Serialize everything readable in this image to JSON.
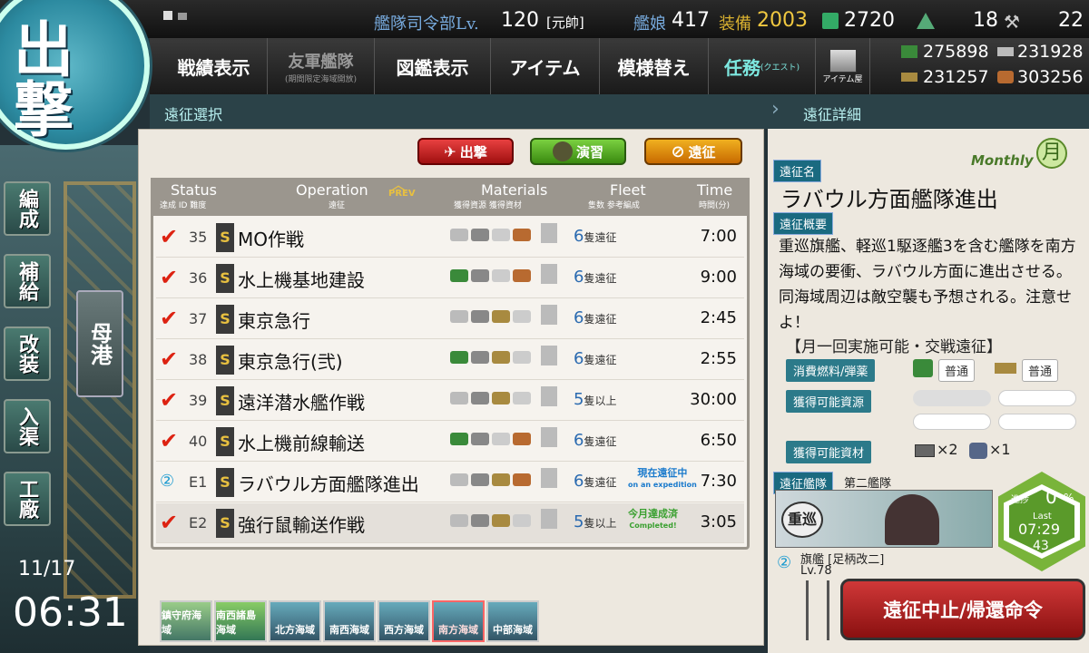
{
  "header": {
    "hq_label": "艦隊司令部Lv.",
    "hq_level": "120",
    "rank": "[元帥]",
    "ships_label": "艦娘",
    "ships": "417",
    "equip_label": "装備",
    "equip": "2003",
    "bucket": "2720",
    "devmat": "18",
    "screws": "22"
  },
  "resources": {
    "fuel": "275898",
    "ammo": "231928",
    "steel": "231257",
    "bauxite": "303256"
  },
  "menu": {
    "record": "戦績表示",
    "friend": "友軍艦隊",
    "friend_sub": "(期間限定海域開放)",
    "album": "図鑑表示",
    "item": "アイテム",
    "remodel": "模様替え",
    "quest": "任務",
    "quest_sub": "(クエスト)",
    "shop": "アイテム屋"
  },
  "sections": {
    "left": "遠征選択",
    "right": "遠征詳細"
  },
  "sortie": "出撃",
  "sidebar": {
    "fleet": "編成",
    "supply": "補給",
    "remodel": "改装",
    "dock": "入渠",
    "factory": "工廠",
    "home": "母港"
  },
  "clock": {
    "date": "11/17",
    "time": "06:31"
  },
  "tabs": {
    "sortie": "出撃",
    "practice": "演習",
    "expedition": "遠征"
  },
  "table_header": {
    "status": "Status",
    "status_sub": "達成 ID 難度",
    "operation": "Operation",
    "operation_sub": "遠征",
    "prev": "PREV",
    "materials": "Materials",
    "materials_sub": "獲得資源 獲得資材",
    "fleet": "Fleet",
    "fleet_sub": "隻数 参考編成",
    "time": "Time",
    "time_sub": "時間(分)"
  },
  "rows": [
    {
      "id": "35",
      "name": "MO作戦",
      "count": "6",
      "unit": "隻遠征",
      "time": "7:00"
    },
    {
      "id": "36",
      "name": "水上機基地建設",
      "count": "6",
      "unit": "隻遠征",
      "time": "9:00"
    },
    {
      "id": "37",
      "name": "東京急行",
      "count": "6",
      "unit": "隻遠征",
      "time": "2:45"
    },
    {
      "id": "38",
      "name": "東京急行(弐)",
      "count": "6",
      "unit": "隻遠征",
      "time": "2:55"
    },
    {
      "id": "39",
      "name": "遠洋潜水艦作戦",
      "count": "5",
      "unit": "隻以上",
      "time": "30:00"
    },
    {
      "id": "40",
      "name": "水上機前線輸送",
      "count": "6",
      "unit": "隻遠征",
      "time": "6:50"
    },
    {
      "id": "E1",
      "name": "ラバウル方面艦隊進出",
      "count": "6",
      "unit": "隻遠征",
      "time": "7:30",
      "status": "現在遠征中",
      "status_en": "on an expedition"
    },
    {
      "id": "E2",
      "name": "強行鼠輸送作戦",
      "count": "5",
      "unit": "隻以上",
      "time": "3:05",
      "status": "今月達成済",
      "status_en": "Completed!"
    }
  ],
  "seas": [
    "鎮守府海域",
    "南西諸島海域",
    "北方海域",
    "南西海域",
    "西方海域",
    "南方海域",
    "中部海域"
  ],
  "detail": {
    "name_tag": "遠征名",
    "monthly": "Monthly",
    "monthly_kanji": "月",
    "name": "ラバウル方面艦隊進出",
    "summary_tag": "遠征概要",
    "desc": "重巡旗艦、軽巡1駆逐艦3を含む艦隊を南方海域の要衝、ラバウル方面に進出させる。同海域周辺は敵空襲も予想される。注意せよ！",
    "note": "【月一回実施可能・交戦遠征】",
    "consume_tag": "消費燃料/弾薬",
    "fuel_cost": "普通",
    "ammo_cost": "普通",
    "res_tag": "獲得可能資源",
    "mat_tag": "獲得可能資材",
    "mat1": "×2",
    "mat2": "×1",
    "fleet_tag": "遠征艦隊",
    "fleet_name": "第二艦隊",
    "flagship": "旗艦 [足柄改二]",
    "level": "Lv.78",
    "ship_kanji": "重巡",
    "progress_label": "進捗",
    "progress": "0",
    "progress_unit": "%",
    "last_label": "Last",
    "last_time": "07:29",
    "last_min": "43",
    "recall": "遠征中止/帰還命令"
  }
}
